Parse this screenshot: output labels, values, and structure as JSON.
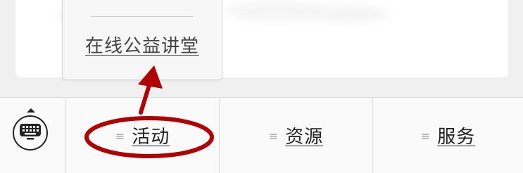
{
  "popup_menu": {
    "items": [
      {
        "label": "在线公益讲堂"
      }
    ]
  },
  "tabbar": {
    "keyboard_toggle_icon": "keyboard-icon",
    "tabs": [
      {
        "label": "活动",
        "icon": "menu-lines-icon"
      },
      {
        "label": "资源",
        "icon": "menu-lines-icon"
      },
      {
        "label": "服务",
        "icon": "menu-lines-icon"
      }
    ]
  },
  "annotation_color": "#b00000"
}
